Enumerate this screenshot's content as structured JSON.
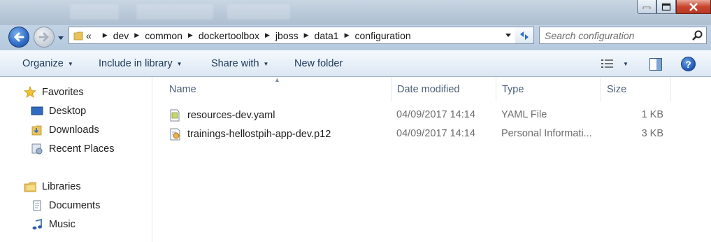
{
  "window": {
    "controls": {
      "minimize_icon": "minimize-icon",
      "maximize_icon": "maximize-icon",
      "close_icon": "close-icon"
    }
  },
  "nav": {
    "address_crumbs": [
      "dev",
      "common",
      "dockertoolbox",
      "jboss",
      "data1",
      "configuration"
    ],
    "overflow_glyph": "«",
    "search_placeholder": "Search configuration"
  },
  "toolbar": {
    "organize": "Organize",
    "include_in_library": "Include in library",
    "share_with": "Share with",
    "new_folder": "New folder",
    "help": "?"
  },
  "sidebar": {
    "favorites": {
      "label": "Favorites",
      "icon": "star-icon"
    },
    "favorite_items": [
      {
        "label": "Desktop",
        "icon": "desktop-icon"
      },
      {
        "label": "Downloads",
        "icon": "downloads-folder-icon"
      },
      {
        "label": "Recent Places",
        "icon": "recent-places-icon"
      }
    ],
    "libraries": {
      "label": "Libraries",
      "icon": "libraries-icon"
    },
    "library_items": [
      {
        "label": "Documents",
        "icon": "documents-icon"
      },
      {
        "label": "Music",
        "icon": "music-icon"
      }
    ]
  },
  "file_list": {
    "columns": [
      "Name",
      "Date modified",
      "Type",
      "Size"
    ],
    "rows": [
      {
        "name": "resources-dev.yaml",
        "date": "04/09/2017 14:14",
        "type": "YAML File",
        "size": "1 KB",
        "icon": "yaml-file-icon"
      },
      {
        "name": "trainings-hellostpih-app-dev.p12",
        "date": "04/09/2017 14:14",
        "type": "Personal Informati...",
        "size": "3 KB",
        "icon": "certificate-file-icon"
      }
    ]
  },
  "colors": {
    "accent": "#1e395b",
    "address_border": "#8293a8",
    "title_gradient": "#b7c7d8"
  }
}
